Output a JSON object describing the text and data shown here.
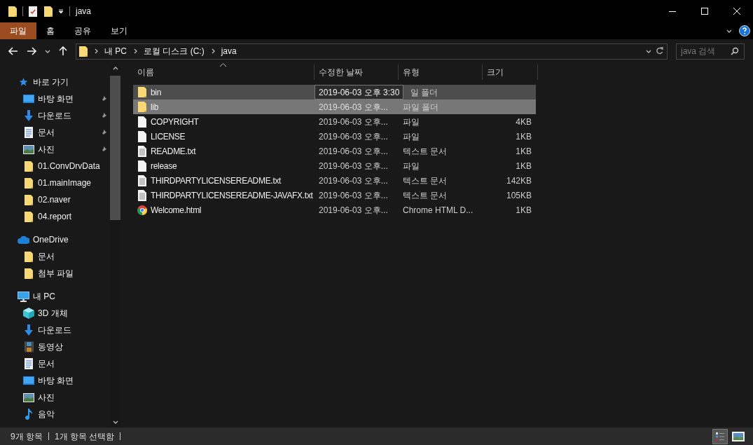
{
  "window": {
    "title": "java"
  },
  "ribbon_tabs": [
    {
      "label": "파일",
      "selected": true
    },
    {
      "label": "홈",
      "selected": false
    },
    {
      "label": "공유",
      "selected": false
    },
    {
      "label": "보기",
      "selected": false
    }
  ],
  "breadcrumb": [
    "내 PC",
    "로컬 디스크 (C:)",
    "java"
  ],
  "search": {
    "placeholder": "java 검색"
  },
  "sidebar": {
    "sections": [
      {
        "label": "바로 가기",
        "kind": "star",
        "children": [
          {
            "label": "바탕 화면",
            "kind": "desktop",
            "pinned": true
          },
          {
            "label": "다운로드",
            "kind": "download",
            "pinned": true
          },
          {
            "label": "문서",
            "kind": "document",
            "pinned": true
          },
          {
            "label": "사진",
            "kind": "pictures",
            "pinned": true
          },
          {
            "label": "01.ConvDrvData",
            "kind": "folder",
            "pinned": false
          },
          {
            "label": "01.mainImage",
            "kind": "folder",
            "pinned": false
          },
          {
            "label": "02.naver",
            "kind": "folder",
            "pinned": false
          },
          {
            "label": "04.report",
            "kind": "folder",
            "pinned": false
          }
        ]
      },
      {
        "label": "OneDrive",
        "kind": "cloud",
        "children": [
          {
            "label": "문서",
            "kind": "folder",
            "pinned": false
          },
          {
            "label": "첨부 파일",
            "kind": "folder",
            "pinned": false
          }
        ]
      },
      {
        "label": "내 PC",
        "kind": "pc",
        "children": [
          {
            "label": "3D 개체",
            "kind": "cube",
            "pinned": false
          },
          {
            "label": "다운로드",
            "kind": "download",
            "pinned": false
          },
          {
            "label": "동영상",
            "kind": "video",
            "pinned": false
          },
          {
            "label": "문서",
            "kind": "document",
            "pinned": false
          },
          {
            "label": "바탕 화면",
            "kind": "desktop",
            "pinned": false
          },
          {
            "label": "사진",
            "kind": "pictures",
            "pinned": false
          },
          {
            "label": "음악",
            "kind": "music",
            "pinned": false
          }
        ]
      }
    ]
  },
  "table": {
    "columns": [
      "이름",
      "수정한 날짜",
      "유형",
      "크기"
    ],
    "rows": [
      {
        "name": "bin",
        "kind": "folder",
        "type": "일 폴더",
        "size": "",
        "selected": false,
        "hovered": true
      },
      {
        "name": "lib",
        "kind": "folder",
        "date": "2019-06-03 오후...",
        "type": "파일 폴더",
        "size": "",
        "selected": true,
        "hovered": false
      },
      {
        "name": "COPYRIGHT",
        "kind": "file",
        "date": "2019-06-03 오후...",
        "type": "파일",
        "size": "4KB",
        "selected": false,
        "hovered": false
      },
      {
        "name": "LICENSE",
        "kind": "file",
        "date": "2019-06-03 오후...",
        "type": "파일",
        "size": "1KB",
        "selected": false,
        "hovered": false
      },
      {
        "name": "README.txt",
        "kind": "text",
        "date": "2019-06-03 오후...",
        "type": "텍스트 문서",
        "size": "1KB",
        "selected": false,
        "hovered": false
      },
      {
        "name": "release",
        "kind": "file",
        "date": "2019-06-03 오후...",
        "type": "파일",
        "size": "1KB",
        "selected": false,
        "hovered": false
      },
      {
        "name": "THIRDPARTYLICENSEREADME.txt",
        "kind": "text",
        "date": "2019-06-03 오후...",
        "type": "텍스트 문서",
        "size": "142KB",
        "selected": false,
        "hovered": false
      },
      {
        "name": "THIRDPARTYLICENSEREADME-JAVAFX.txt",
        "kind": "text",
        "date": "2019-06-03 오후...",
        "type": "텍스트 문서",
        "size": "105KB",
        "selected": false,
        "hovered": false
      },
      {
        "name": "Welcome.html",
        "kind": "html",
        "date": "2019-06-03 오후...",
        "type": "Chrome HTML D...",
        "size": "1KB",
        "selected": false,
        "hovered": false
      }
    ]
  },
  "tooltip": "2019-06-03 오후 3:30",
  "status_bar": {
    "items": [
      "9개 항목",
      "1개 항목 선택함"
    ]
  }
}
